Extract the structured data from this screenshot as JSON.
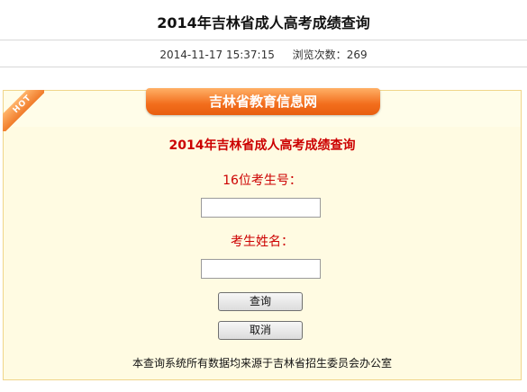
{
  "header": {
    "title": "2014年吉林省成人高考成绩查询",
    "date": "2014-11-17 15:37:15",
    "views_label": "浏览次数：",
    "views_count": "269"
  },
  "panel": {
    "ribbon": "HOT",
    "tab_title": "吉林省教育信息网",
    "form_title": "2014年吉林省成人高考成绩查询",
    "exam_no_label": "16位考生号：",
    "exam_no_value": "",
    "name_label": "考生姓名：",
    "name_value": "",
    "query_button": "查询",
    "cancel_button": "取消",
    "footer_note": "本查询系统所有数据均来源于吉林省招生委员会办公室"
  }
}
